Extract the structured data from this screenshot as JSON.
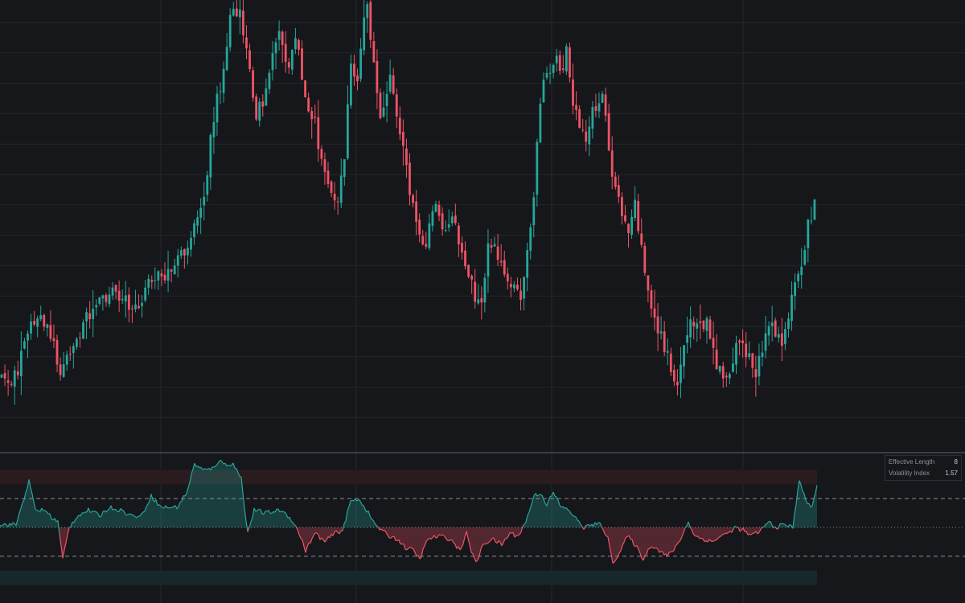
{
  "chart_data": [
    {
      "type": "candlestick",
      "title": "",
      "panel": "price",
      "grid": true,
      "colors": {
        "up": "#26a69a",
        "down": "#ef5366",
        "background": "#16171b",
        "grid": "#25262b"
      },
      "ylim": [
        0,
        100
      ],
      "anchors": [
        [
          0,
          16
        ],
        [
          12,
          16
        ],
        [
          22,
          16
        ],
        [
          35,
          28
        ],
        [
          50,
          30
        ],
        [
          60,
          28
        ],
        [
          75,
          18
        ],
        [
          90,
          24
        ],
        [
          110,
          30
        ],
        [
          135,
          36
        ],
        [
          150,
          34
        ],
        [
          170,
          32
        ],
        [
          190,
          40
        ],
        [
          205,
          40
        ],
        [
          225,
          44
        ],
        [
          240,
          50
        ],
        [
          250,
          56
        ],
        [
          258,
          64
        ],
        [
          268,
          78
        ],
        [
          278,
          86
        ],
        [
          286,
          98
        ],
        [
          292,
          101
        ],
        [
          300,
          98
        ],
        [
          308,
          90
        ],
        [
          318,
          74
        ],
        [
          328,
          80
        ],
        [
          338,
          89
        ],
        [
          348,
          94
        ],
        [
          358,
          86
        ],
        [
          368,
          96
        ],
        [
          378,
          80
        ],
        [
          390,
          76
        ],
        [
          400,
          65
        ],
        [
          410,
          60
        ],
        [
          420,
          56
        ],
        [
          428,
          66
        ],
        [
          436,
          86
        ],
        [
          446,
          84
        ],
        [
          456,
          102
        ],
        [
          464,
          88
        ],
        [
          474,
          72
        ],
        [
          484,
          84
        ],
        [
          494,
          76
        ],
        [
          504,
          66
        ],
        [
          512,
          56
        ],
        [
          520,
          50
        ],
        [
          528,
          46
        ],
        [
          540,
          56
        ],
        [
          552,
          50
        ],
        [
          562,
          54
        ],
        [
          572,
          46
        ],
        [
          582,
          40
        ],
        [
          592,
          34
        ],
        [
          600,
          36
        ],
        [
          608,
          48
        ],
        [
          618,
          44
        ],
        [
          628,
          38
        ],
        [
          638,
          36
        ],
        [
          648,
          34
        ],
        [
          656,
          44
        ],
        [
          664,
          60
        ],
        [
          672,
          80
        ],
        [
          680,
          87
        ],
        [
          688,
          88
        ],
        [
          696,
          86
        ],
        [
          704,
          90
        ],
        [
          712,
          80
        ],
        [
          720,
          72
        ],
        [
          730,
          72
        ],
        [
          740,
          78
        ],
        [
          750,
          80
        ],
        [
          758,
          66
        ],
        [
          766,
          60
        ],
        [
          774,
          52
        ],
        [
          782,
          50
        ],
        [
          790,
          56
        ],
        [
          798,
          44
        ],
        [
          806,
          36
        ],
        [
          814,
          28
        ],
        [
          822,
          26
        ],
        [
          832,
          20
        ],
        [
          842,
          14
        ],
        [
          852,
          24
        ],
        [
          862,
          30
        ],
        [
          872,
          26
        ],
        [
          880,
          30
        ],
        [
          888,
          22
        ],
        [
          896,
          18
        ],
        [
          904,
          14
        ],
        [
          912,
          22
        ],
        [
          922,
          26
        ],
        [
          932,
          20
        ],
        [
          940,
          18
        ],
        [
          950,
          24
        ],
        [
          960,
          28
        ],
        [
          970,
          24
        ],
        [
          980,
          30
        ],
        [
          990,
          38
        ],
        [
          1000,
          46
        ],
        [
          1008,
          52
        ],
        [
          1016,
          60
        ]
      ]
    },
    {
      "type": "area",
      "panel": "indicator",
      "zones": {
        "upper_zone": [
          0.75,
          1.0
        ],
        "lower_zone": [
          -1.0,
          -0.75
        ]
      },
      "levels": {
        "upper": 0.5,
        "mid": 0.0,
        "lower": -0.5
      },
      "colors": {
        "positive": "#26a69a",
        "negative": "#ef5366"
      },
      "ylim": [
        -1.2,
        1.2
      ],
      "anchors": [
        [
          0,
          0.05
        ],
        [
          20,
          0.05
        ],
        [
          36,
          0.8
        ],
        [
          44,
          0.3
        ],
        [
          56,
          0.3
        ],
        [
          66,
          0.15
        ],
        [
          72,
          0.1
        ],
        [
          78,
          -0.55
        ],
        [
          86,
          0.0
        ],
        [
          96,
          0.2
        ],
        [
          110,
          0.3
        ],
        [
          124,
          0.2
        ],
        [
          136,
          0.35
        ],
        [
          150,
          0.3
        ],
        [
          164,
          0.2
        ],
        [
          176,
          0.2
        ],
        [
          188,
          0.55
        ],
        [
          200,
          0.35
        ],
        [
          220,
          0.35
        ],
        [
          232,
          0.6
        ],
        [
          242,
          1.1
        ],
        [
          252,
          1.0
        ],
        [
          262,
          1.0
        ],
        [
          272,
          1.15
        ],
        [
          280,
          1.1
        ],
        [
          290,
          1.1
        ],
        [
          300,
          0.85
        ],
        [
          308,
          -0.1
        ],
        [
          316,
          0.3
        ],
        [
          330,
          0.25
        ],
        [
          350,
          0.3
        ],
        [
          362,
          0.15
        ],
        [
          372,
          -0.1
        ],
        [
          380,
          -0.4
        ],
        [
          392,
          -0.1
        ],
        [
          404,
          -0.25
        ],
        [
          416,
          -0.1
        ],
        [
          426,
          -0.05
        ],
        [
          436,
          0.45
        ],
        [
          446,
          0.5
        ],
        [
          456,
          0.3
        ],
        [
          464,
          0.1
        ],
        [
          474,
          -0.05
        ],
        [
          484,
          -0.15
        ],
        [
          494,
          -0.2
        ],
        [
          504,
          -0.35
        ],
        [
          514,
          -0.4
        ],
        [
          522,
          -0.55
        ],
        [
          532,
          -0.2
        ],
        [
          546,
          -0.15
        ],
        [
          560,
          -0.2
        ],
        [
          572,
          -0.4
        ],
        [
          580,
          -0.1
        ],
        [
          588,
          -0.5
        ],
        [
          594,
          -0.6
        ],
        [
          600,
          -0.3
        ],
        [
          612,
          -0.2
        ],
        [
          624,
          -0.3
        ],
        [
          634,
          -0.1
        ],
        [
          644,
          -0.15
        ],
        [
          654,
          0.1
        ],
        [
          664,
          0.55
        ],
        [
          672,
          0.6
        ],
        [
          680,
          0.4
        ],
        [
          688,
          0.6
        ],
        [
          698,
          0.35
        ],
        [
          708,
          0.3
        ],
        [
          716,
          0.15
        ],
        [
          726,
          0.0
        ],
        [
          738,
          0.05
        ],
        [
          748,
          0.05
        ],
        [
          756,
          -0.2
        ],
        [
          762,
          -0.6
        ],
        [
          770,
          -0.45
        ],
        [
          780,
          -0.15
        ],
        [
          790,
          -0.3
        ],
        [
          800,
          -0.55
        ],
        [
          810,
          -0.3
        ],
        [
          820,
          -0.4
        ],
        [
          830,
          -0.5
        ],
        [
          840,
          -0.35
        ],
        [
          848,
          -0.15
        ],
        [
          856,
          0.1
        ],
        [
          864,
          -0.15
        ],
        [
          874,
          -0.2
        ],
        [
          886,
          -0.25
        ],
        [
          896,
          -0.15
        ],
        [
          906,
          -0.1
        ],
        [
          914,
          0.0
        ],
        [
          924,
          -0.05
        ],
        [
          934,
          -0.15
        ],
        [
          946,
          -0.05
        ],
        [
          956,
          0.1
        ],
        [
          964,
          0.0
        ],
        [
          976,
          0.05
        ],
        [
          986,
          0.0
        ],
        [
          994,
          0.85
        ],
        [
          1002,
          0.45
        ],
        [
          1010,
          0.35
        ],
        [
          1016,
          0.75
        ]
      ]
    }
  ],
  "info_panel": {
    "rows": [
      {
        "label": "Effective Length",
        "value": "8"
      },
      {
        "label": "Volatility Index",
        "value": "1.57"
      }
    ]
  }
}
